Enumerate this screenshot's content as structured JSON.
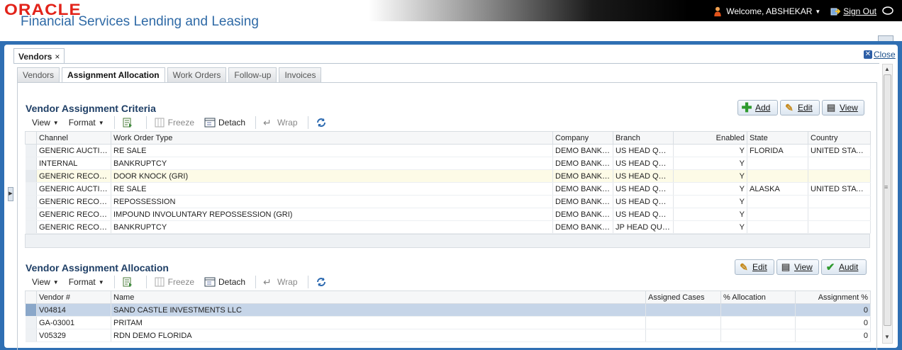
{
  "header": {
    "logo": "ORACLE",
    "product": "Financial Services Lending and Leasing",
    "welcome": "Welcome, ABSHEKAR",
    "sign_out": "Sign Out"
  },
  "task_tab": {
    "label": "Vendors",
    "close_x": "×",
    "close_link": "Close"
  },
  "subtabs": [
    "Vendors",
    "Assignment Allocation",
    "Work Orders",
    "Follow-up",
    "Invoices"
  ],
  "toolbar": {
    "view": "View",
    "format": "Format",
    "freeze": "Freeze",
    "detach": "Detach",
    "wrap": "Wrap"
  },
  "criteria": {
    "title": "Vendor Assignment Criteria",
    "buttons": {
      "add": "Add",
      "edit": "Edit",
      "view": "View"
    },
    "columns": [
      "Channel",
      "Work Order Type",
      "Company",
      "Branch",
      "Enabled",
      "State",
      "Country"
    ],
    "rows": [
      [
        "GENERIC AUCTIO...",
        "RE SALE",
        "DEMO BANK U...",
        "US HEAD QUA...",
        "Y",
        "FLORIDA",
        "UNITED STATES"
      ],
      [
        "INTERNAL",
        "BANKRUPTCY",
        "DEMO BANK U...",
        "US HEAD QUA...",
        "Y",
        "",
        ""
      ],
      [
        "GENERIC RECOVE...",
        "DOOR KNOCK (GRI)",
        "DEMO BANK U...",
        "US HEAD QUA...",
        "Y",
        "",
        ""
      ],
      [
        "GENERIC AUCTIO...",
        "RE SALE",
        "DEMO BANK U...",
        "US HEAD QUA...",
        "Y",
        "ALASKA",
        "UNITED STATES"
      ],
      [
        "GENERIC RECOVE...",
        "REPOSSESSION",
        "DEMO BANK U...",
        "US HEAD QUA...",
        "Y",
        "",
        ""
      ],
      [
        "GENERIC RECOVE...",
        "IMPOUND INVOLUNTARY REPOSSESSION (GRI)",
        "DEMO BANK U...",
        "US HEAD QUA...",
        "Y",
        "",
        ""
      ],
      [
        "GENERIC RECOVE...",
        "BANKRUPTCY",
        "DEMO BANK JP",
        "JP HEAD QUA...",
        "Y",
        "",
        ""
      ]
    ]
  },
  "allocation": {
    "title": "Vendor Assignment Allocation",
    "buttons": {
      "edit": "Edit",
      "view": "View",
      "audit": "Audit"
    },
    "columns": [
      "Vendor #",
      "Name",
      "Assigned Cases",
      "% Allocation",
      "Assignment %"
    ],
    "rows": [
      [
        "V04814",
        "SAND CASTLE INVESTMENTS LLC",
        "",
        "",
        "0"
      ],
      [
        "GA-03001",
        "PRITAM",
        "",
        "",
        "0"
      ],
      [
        "V05329",
        "RDN DEMO FLORIDA",
        "",
        "",
        "0"
      ]
    ]
  },
  "colors": {
    "frame_blue": "#2f6fb3",
    "title_blue": "#1f3f66",
    "selected_row": "#c6d5e8",
    "highlight_row": "#fdfbe7"
  }
}
